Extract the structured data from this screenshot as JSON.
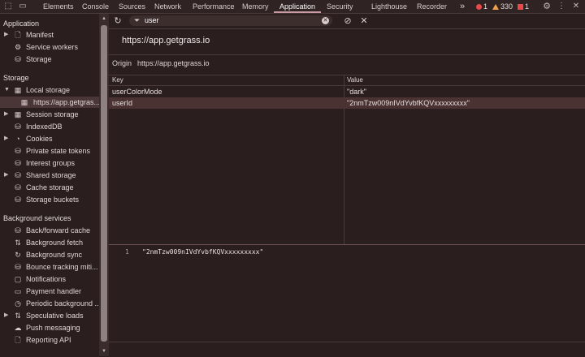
{
  "tabbar": {
    "tabs": [
      "Elements",
      "Console",
      "Sources",
      "Network",
      "Performance",
      "Memory",
      "Application",
      "Security",
      "Lighthouse",
      "Recorder"
    ],
    "more": "»",
    "errors": "1",
    "warnings": "330",
    "issues": "1",
    "error_color": "#e84a4a",
    "warning_color": "#f2a14d"
  },
  "sidebar": {
    "sections": [
      {
        "title": "Application",
        "items": [
          {
            "label": "Manifest",
            "icon": "file-icon",
            "arrow": "▶"
          },
          {
            "label": "Service workers",
            "icon": "gears-icon",
            "arrow": ""
          },
          {
            "label": "Storage",
            "icon": "database-icon",
            "arrow": ""
          }
        ]
      },
      {
        "title": "Storage",
        "items": [
          {
            "label": "Local storage",
            "icon": "grid-icon",
            "arrow": "▼"
          },
          {
            "label": "https://app.getgras...",
            "icon": "grid-icon",
            "arrow": ""
          },
          {
            "label": "Session storage",
            "icon": "grid-icon",
            "arrow": "▶"
          },
          {
            "label": "IndexedDB",
            "icon": "database-icon",
            "arrow": ""
          },
          {
            "label": "Cookies",
            "icon": "cookie-icon",
            "arrow": "▶"
          },
          {
            "label": "Private state tokens",
            "icon": "database-icon",
            "arrow": ""
          },
          {
            "label": "Interest groups",
            "icon": "database-icon",
            "arrow": ""
          },
          {
            "label": "Shared storage",
            "icon": "database-icon",
            "arrow": "▶"
          },
          {
            "label": "Cache storage",
            "icon": "database-icon",
            "arrow": ""
          },
          {
            "label": "Storage buckets",
            "icon": "database-icon",
            "arrow": ""
          }
        ]
      },
      {
        "title": "Background services",
        "items": [
          {
            "label": "Back/forward cache",
            "icon": "database-icon",
            "arrow": ""
          },
          {
            "label": "Background fetch",
            "icon": "arrows-icon",
            "arrow": ""
          },
          {
            "label": "Background sync",
            "icon": "sync-icon",
            "arrow": ""
          },
          {
            "label": "Bounce tracking miti...",
            "icon": "database-icon",
            "arrow": ""
          },
          {
            "label": "Notifications",
            "icon": "bell-icon",
            "arrow": ""
          },
          {
            "label": "Payment handler",
            "icon": "card-icon",
            "arrow": ""
          },
          {
            "label": "Periodic background ...",
            "icon": "clock-icon",
            "arrow": ""
          },
          {
            "label": "Speculative loads",
            "icon": "arrows-icon",
            "arrow": "▶"
          },
          {
            "label": "Push messaging",
            "icon": "cloud-icon",
            "arrow": ""
          },
          {
            "label": "Reporting API",
            "icon": "file-icon",
            "arrow": ""
          }
        ]
      }
    ]
  },
  "main": {
    "filter_value": "user",
    "origin_title": "https://app.getgrass.io",
    "origin_label": "Origin",
    "origin_value": "https://app.getgrass.io",
    "columns": {
      "key": "Key",
      "value": "Value"
    },
    "rows": [
      {
        "key": "userColorMode",
        "value": "\"dark\""
      },
      {
        "key": "userId",
        "value": "\"2nmTzw009nIVdYvbfKQVxxxxxxxxx\""
      }
    ],
    "preview": {
      "line": "1",
      "code": "\"2nmTzw009nIVdYvbfKQVxxxxxxxxx\""
    }
  }
}
